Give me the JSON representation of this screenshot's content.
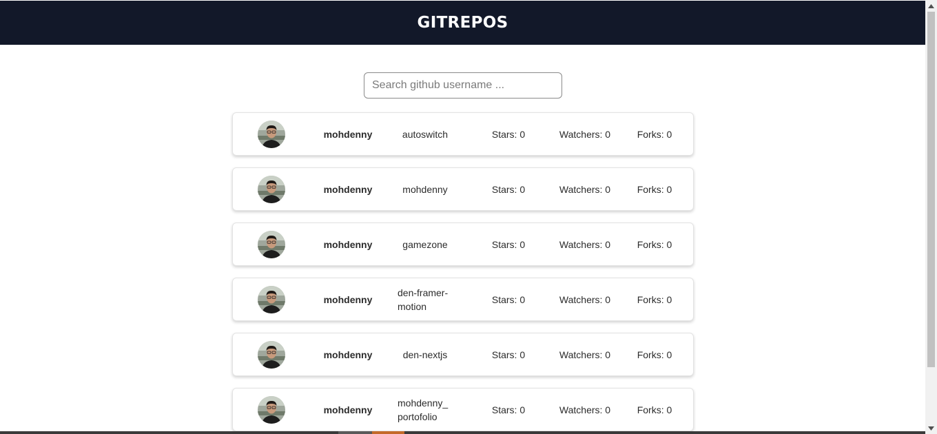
{
  "header": {
    "title": "GITREPOS"
  },
  "search": {
    "placeholder": "Search github username ...",
    "value": ""
  },
  "repos": [
    {
      "owner": "mohdenny",
      "name": "autoswitch",
      "stars": "Stars: 0",
      "watchers": "Watchers: 0",
      "forks": "Forks: 0"
    },
    {
      "owner": "mohdenny",
      "name": "mohdenny",
      "stars": "Stars: 0",
      "watchers": "Watchers: 0",
      "forks": "Forks: 0"
    },
    {
      "owner": "mohdenny",
      "name": "gamezone",
      "stars": "Stars: 0",
      "watchers": "Watchers: 0",
      "forks": "Forks: 0"
    },
    {
      "owner": "mohdenny",
      "name": "den-framer-motion",
      "stars": "Stars: 0",
      "watchers": "Watchers: 0",
      "forks": "Forks: 0"
    },
    {
      "owner": "mohdenny",
      "name": "den-nextjs",
      "stars": "Stars: 0",
      "watchers": "Watchers: 0",
      "forks": "Forks: 0"
    },
    {
      "owner": "mohdenny",
      "name": "mohdenny_portofolio",
      "stars": "Stars: 0",
      "watchers": "Watchers: 0",
      "forks": "Forks: 0"
    }
  ],
  "colors": {
    "header_bg": "#121829",
    "header_text": "#ffffff",
    "card_border": "#e3e3e3"
  },
  "icons": {
    "avatar": "user-avatar-photo",
    "scroll_up": "chevron-up-icon",
    "scroll_down": "chevron-down-icon"
  }
}
